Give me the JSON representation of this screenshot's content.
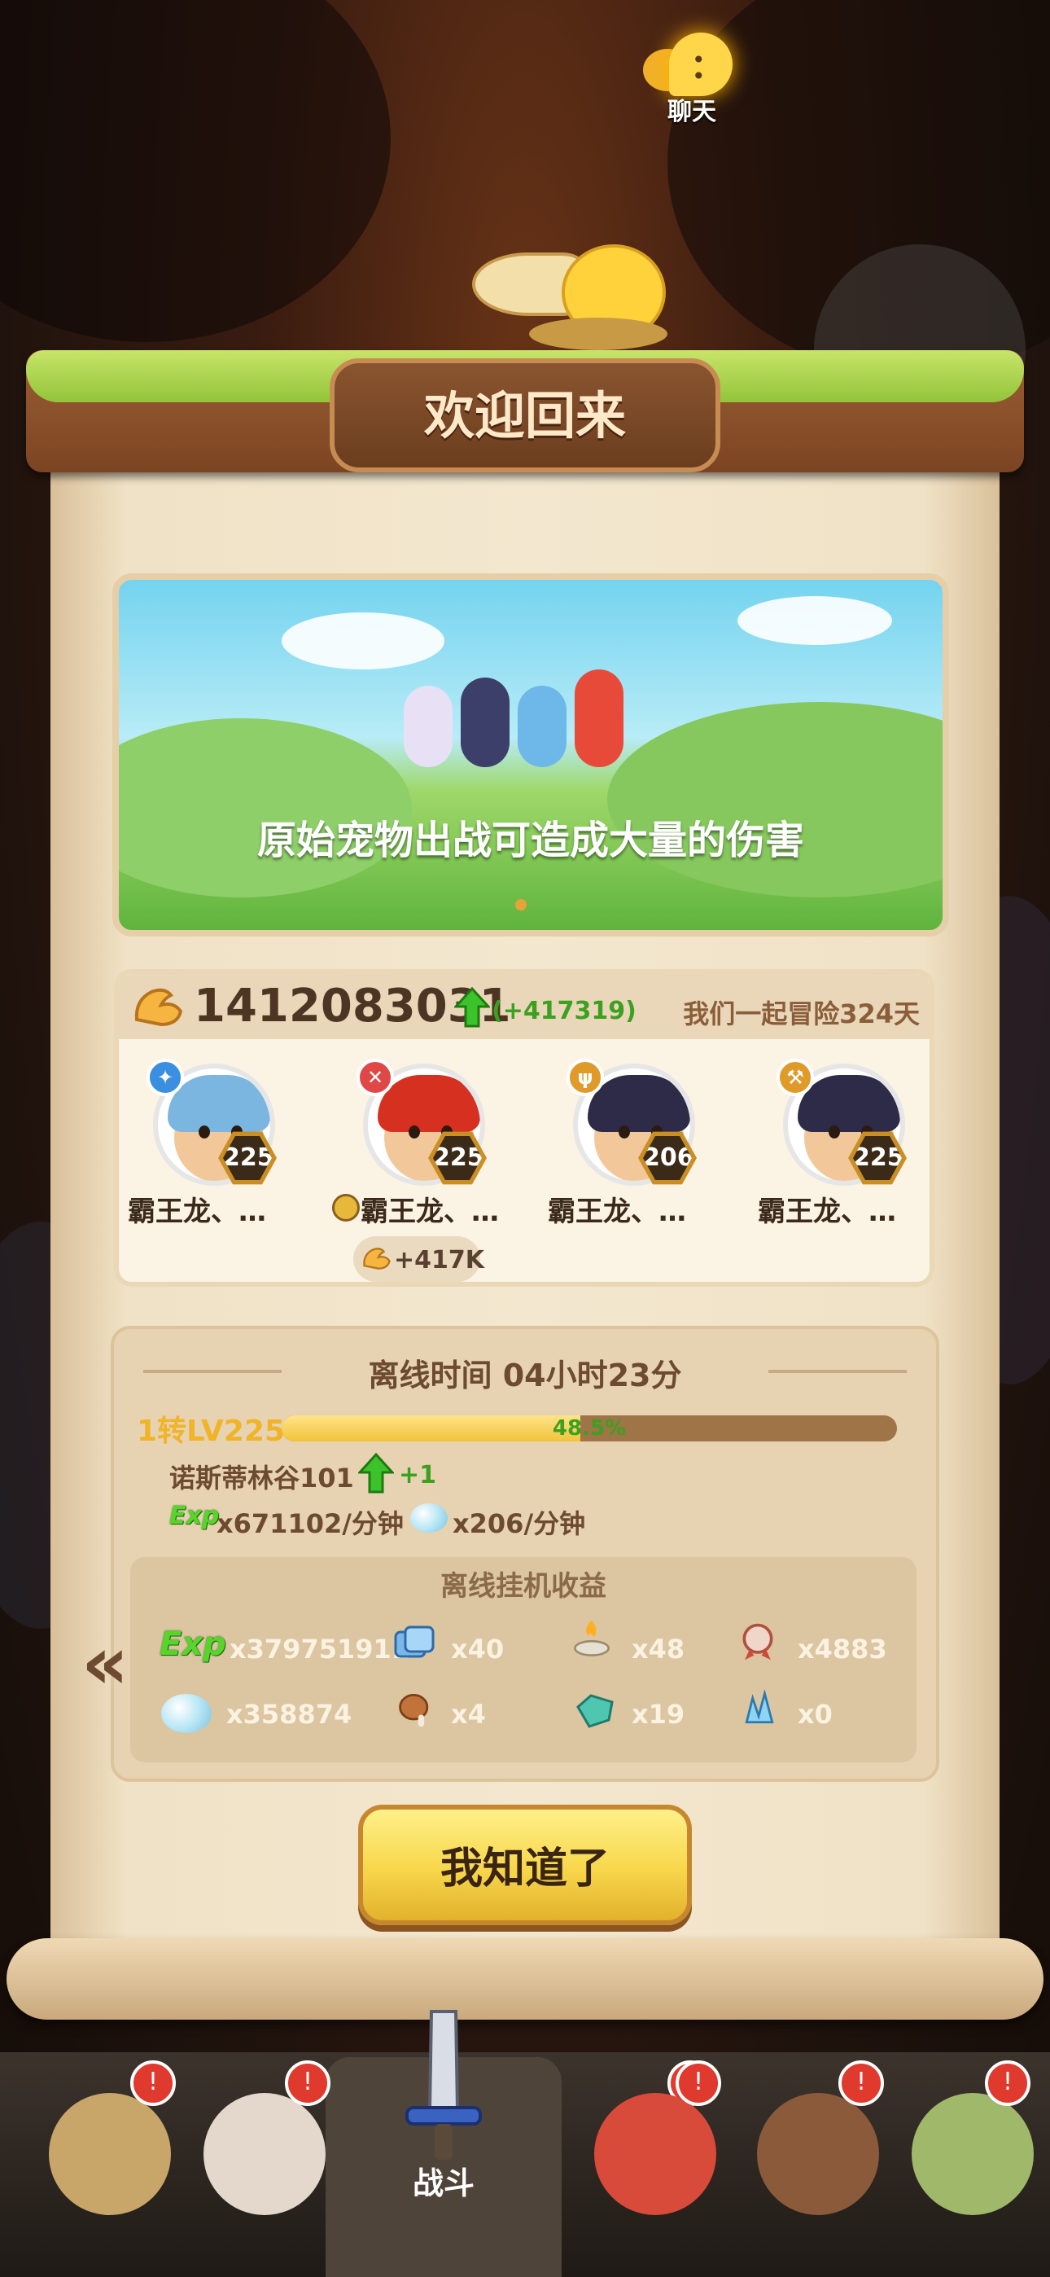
{
  "chat": {
    "label": "聊天",
    "icon": "chat-bubble-icon"
  },
  "dialog": {
    "title": "欢迎回来",
    "banner": {
      "caption": "原始宠物出战可造成大量的伤害",
      "page_index": 1,
      "page_count": 1
    },
    "power": {
      "value": "1412083031",
      "delta": "(+417319)",
      "days": "我们一起冒险324天"
    },
    "heroes": [
      {
        "name": "霸王龙、…",
        "level": "225",
        "element_icon": "swirl-icon",
        "element_color": "#3a8fe0",
        "hair_color": "#7ab6df",
        "leader": false
      },
      {
        "name": "霸王龙、…",
        "level": "225",
        "element_icon": "crossed-swords-icon",
        "element_color": "#e04848",
        "hair_color": "#d63020",
        "leader": true
      },
      {
        "name": "霸王龙、…",
        "level": "206",
        "element_icon": "trident-icon",
        "element_color": "#e09a2a",
        "hair_color": "#2d2b48",
        "leader": false
      },
      {
        "name": "霸王龙、…",
        "level": "225",
        "element_icon": "axe-icon",
        "element_color": "#e09a2a",
        "hair_color": "#2d2b48",
        "leader": false
      }
    ],
    "hero_bonus": "+417K",
    "offline": {
      "time_label": "离线时间 04小时23分",
      "level_label": "1转LV225",
      "level_progress": 0.485,
      "level_percent_text": "48.5%",
      "stage": "诺斯蒂林谷101",
      "stage_gain": "+1",
      "exp_tag": "Exp",
      "exp_rate": "x671102/分钟",
      "gem_rate": "x206/分钟",
      "earnings_title": "离线挂机收益",
      "earnings": [
        {
          "icon": "exp-icon",
          "amount": "x379751911"
        },
        {
          "icon": "ticket-icon",
          "amount": "x40"
        },
        {
          "icon": "fire-altar-icon",
          "amount": "x48"
        },
        {
          "icon": "medal-icon",
          "amount": "x4883"
        },
        {
          "icon": "gem-icon",
          "amount": "x358874"
        },
        {
          "icon": "meat-icon",
          "amount": "x4"
        },
        {
          "icon": "green-crystal-icon",
          "amount": "x19"
        },
        {
          "icon": "blue-shard-icon",
          "amount": "x0"
        }
      ]
    },
    "confirm_button": "我知道了"
  },
  "bottom_nav": {
    "tabs": [
      {
        "id": "tab-caveman",
        "alert": true
      },
      {
        "id": "tab-hero",
        "alert": true
      },
      {
        "id": "tab-battle",
        "label": "战斗",
        "active": true,
        "alert": true
      },
      {
        "id": "tab-pet",
        "alert": true
      },
      {
        "id": "tab-beast",
        "alert": true
      },
      {
        "id": "tab-tribe",
        "alert": true
      }
    ]
  },
  "colors": {
    "accent_green": "#3ca020",
    "title_text": "#ffe9c8",
    "panel_text": "#6d4b30",
    "button_yellow": "#f7d64a",
    "alert_red": "#e0392e"
  }
}
